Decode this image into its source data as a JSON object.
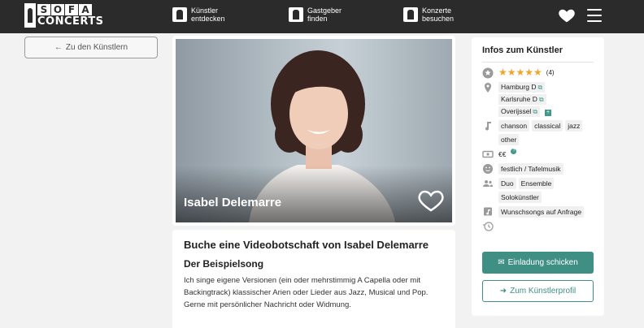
{
  "header": {
    "logo_letters": [
      "S",
      "O",
      "F",
      "A"
    ],
    "logo_sub": "CONCERTS",
    "nav": [
      {
        "line1": "Künstler",
        "line2": "entdecken"
      },
      {
        "line1": "Gastgeber",
        "line2": "finden"
      },
      {
        "line1": "Konzerte",
        "line2": "besuchen"
      }
    ],
    "icons": [
      "heart-icon",
      "menu-icon"
    ]
  },
  "back_button": {
    "label": "Zu den Künstlern",
    "icon": "arrow-left-icon"
  },
  "artist": {
    "name": "Isabel Delemarre"
  },
  "description": {
    "title": "Buche eine Videobotschaft von Isabel Delemarre",
    "subtitle": "Der Beispielsong",
    "text": "Ich singe eigene Versionen (ein oder mehrstimmig A Capella oder mit Backingtrack) klassischer Arien oder Lieder aus Jazz, Musical und Pop. Gerne mit persönlicher Nachricht oder Widmung."
  },
  "info": {
    "title": "Infos zum Künstler",
    "rating_stars": 5,
    "rating_count": "(4)",
    "locations": [
      "Hamburg D",
      "Karlsruhe D",
      "Overijssel"
    ],
    "genres": [
      "chanson",
      "classical",
      "jazz",
      "other"
    ],
    "price": "€€",
    "occasion": "festlich / Tafelmusik",
    "formation": [
      "Duo",
      "Ensemble",
      "Solokünstler"
    ],
    "songs": "Wunschsongs auf Anfrage",
    "invite_label": "Einladung schicken",
    "profile_label": "Zum Künstlerprofil"
  },
  "colors": {
    "accent": "#3f8f85",
    "star": "#f0a62a",
    "topbar": "#2b2b2b"
  }
}
